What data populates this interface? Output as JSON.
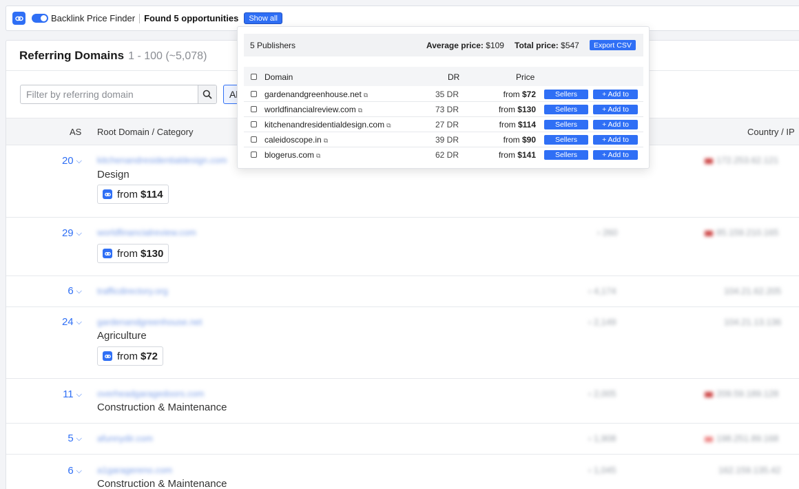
{
  "extension": {
    "name": "Backlink Price Finder",
    "found_text": "Found 5 opportunities",
    "show_all_label": "Show all"
  },
  "panel": {
    "title": "Referring Domains",
    "count": "1 - 100 (~5,078)",
    "filter_placeholder": "Filter by referring domain",
    "all_label": "Al",
    "columns": {
      "as": "AS",
      "root_domain": "Root Domain / Category",
      "country_ip": "Country / IP"
    }
  },
  "rows": [
    {
      "as": "20",
      "domain": "kitchenandresidentialdesign.com",
      "category": "Design",
      "price_prefix": "from",
      "price": "$114",
      "backlinks": "",
      "ip": "172.253.62.121"
    },
    {
      "as": "29",
      "domain": "worldfinancialreview.com",
      "category": "",
      "price_prefix": "from",
      "price": "$130",
      "backlinks": "260",
      "ip": "85.159.210.165"
    },
    {
      "as": "6",
      "domain": "trafficdirectory.org",
      "category": "",
      "price_prefix": "",
      "price": "",
      "backlinks": "4,174",
      "ip": "104.21.62.205"
    },
    {
      "as": "24",
      "domain": "gardenandgreenhouse.net",
      "category": "Agriculture",
      "price_prefix": "from",
      "price": "$72",
      "backlinks": "2,149",
      "ip": "104.21.13.136"
    },
    {
      "as": "11",
      "domain": "overheadgaragedoors.com",
      "category": "Construction & Maintenance",
      "price_prefix": "",
      "price": "",
      "backlinks": "2,005",
      "ip": "209.59.189.128"
    },
    {
      "as": "5",
      "domain": "afunnydir.com",
      "category": "",
      "price_prefix": "",
      "price": "",
      "backlinks": "1,908",
      "ip": "198.251.89.168"
    },
    {
      "as": "6",
      "domain": "a1garagereno.com",
      "category": "Construction & Maintenance",
      "price_prefix": "",
      "price": "",
      "backlinks": "1,045",
      "ip": "162.159.135.42"
    }
  ],
  "popup": {
    "publishers": "5 Publishers",
    "avg_label": "Average price:",
    "avg_value": "$109",
    "total_label": "Total price:",
    "total_value": "$547",
    "export_label": "Export CSV",
    "columns": {
      "domain": "Domain",
      "dr": "DR",
      "price": "Price"
    },
    "sellers_label": "Sellers",
    "add_label": "+ Add to",
    "items": [
      {
        "domain": "gardenandgreenhouse.net",
        "dr": "35 DR",
        "price_prefix": "from",
        "price": "$72"
      },
      {
        "domain": "worldfinancialreview.com",
        "dr": "73 DR",
        "price_prefix": "from",
        "price": "$130"
      },
      {
        "domain": "kitchenandresidentialdesign.com",
        "dr": "27 DR",
        "price_prefix": "from",
        "price": "$114"
      },
      {
        "domain": "caleidoscope.in",
        "dr": "39 DR",
        "price_prefix": "from",
        "price": "$90"
      },
      {
        "domain": "blogerus.com",
        "dr": "62 DR",
        "price_prefix": "from",
        "price": "$141"
      }
    ]
  },
  "colors": {
    "accent": "#2f6ff5",
    "header_bg": "#f4f5f7"
  }
}
